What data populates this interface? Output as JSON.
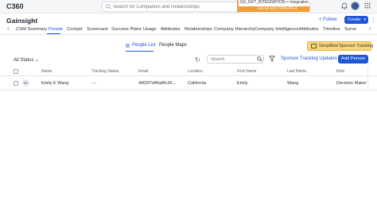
{
  "app": {
    "name": "C360"
  },
  "global_search": {
    "placeholder": "Search for Companies and Relationships"
  },
  "integration_banner": {
    "line1": "GS_NXT_INTEGRATION > Integration Env",
    "line2": "GS-GI-QO-7Z04-PS-4"
  },
  "header": {
    "company": "Gainsight",
    "follow": "+ Follow",
    "create": "Create"
  },
  "tabs": [
    "CSM Summary",
    "People",
    "Cockpit",
    "Scorecard",
    "Success Plans",
    "Usage",
    "Attributes",
    "Relationships",
    "Company Hierarchy",
    "Company Intelligence",
    "Attributes",
    "Timeline",
    "Surve"
  ],
  "active_tab": "People",
  "subtabs": {
    "people_list": "People List",
    "people_maps": "People Maps"
  },
  "simplified_button": "Simplified Sponsor Tracking",
  "toolbar": {
    "status_filter": "All Status",
    "search_placeholder": "Search",
    "tracking_updates": "Sponsor Tracking Updates",
    "add_person": "Add Person"
  },
  "table": {
    "columns": [
      "Name",
      "Tracking Status",
      "Email",
      "Location",
      "First Name",
      "Last Name",
      "Role"
    ],
    "rows": [
      {
        "initials": "EE",
        "name": "Emily E Wang",
        "tracking_status": "---",
        "email": "4402f7d46a8fc36...",
        "location": "California",
        "first_name": "Emily",
        "last_name": "Wang",
        "role": "Decision Maker"
      }
    ]
  },
  "colors": {
    "accent": "#1f56d6",
    "highlight": "#f7d678",
    "banner": "#f29d38"
  }
}
